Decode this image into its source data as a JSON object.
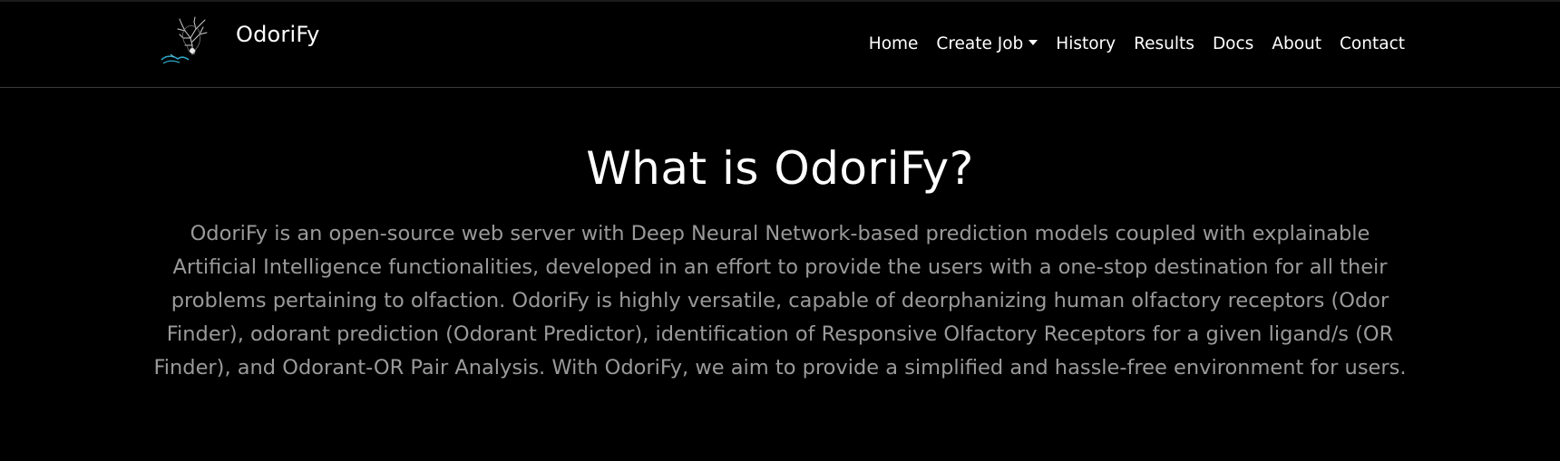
{
  "brand": {
    "name": "OdoriFy",
    "logo_icon": "tree-head-logo-icon"
  },
  "nav": {
    "items": [
      {
        "label": "Home"
      },
      {
        "label": "Create Job",
        "has_dropdown": true
      },
      {
        "label": "History"
      },
      {
        "label": "Results"
      },
      {
        "label": "Docs"
      },
      {
        "label": "About"
      },
      {
        "label": "Contact"
      }
    ]
  },
  "hero": {
    "title": "What is OdoriFy?",
    "description": "OdoriFy is an open-source web server with Deep Neural Network-based prediction models coupled with explainable Artificial Intelligence functionalities, developed in an effort to provide the users with a one-stop destination for all their problems pertaining to olfaction. OdoriFy is highly versatile, capable of deorphanizing human olfactory receptors (Odor Finder), odorant prediction (Odorant Predictor), identification of Responsive Olfactory Receptors for a given ligand/s (OR Finder), and Odorant-OR Pair Analysis. With OdoriFy, we aim to provide a simplified and hassle-free environment for users."
  },
  "colors": {
    "background": "#000000",
    "text_primary": "#ffffff",
    "text_muted": "#9a9a9a",
    "divider": "#3a3a3a",
    "logo_accent": "#2fa7c7"
  }
}
